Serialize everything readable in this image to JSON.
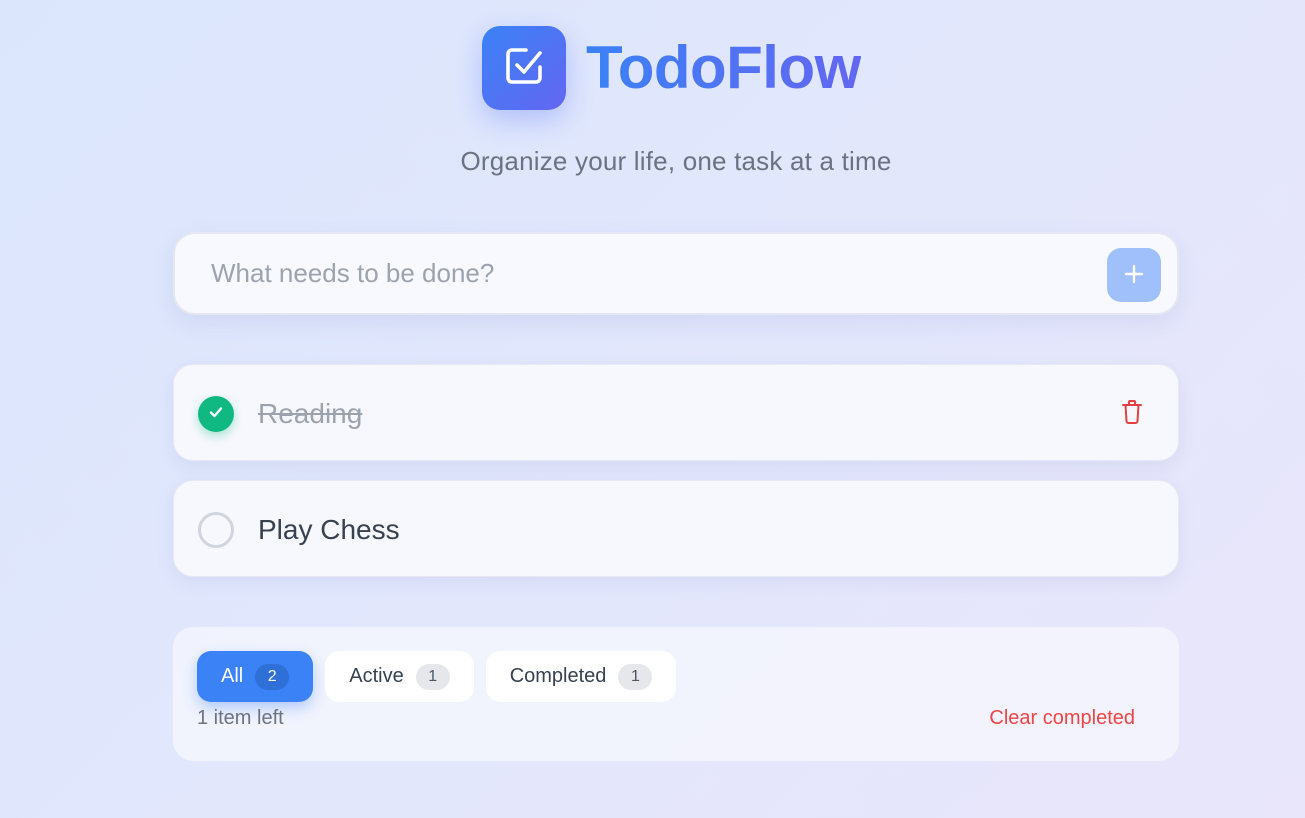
{
  "header": {
    "title": "TodoFlow",
    "tagline": "Organize your life, one task at a time",
    "logo_icon": "checkbox-icon"
  },
  "input": {
    "placeholder": "What needs to be done?",
    "value": "",
    "add_icon": "plus-icon"
  },
  "todos": [
    {
      "text": "Reading",
      "completed": true
    },
    {
      "text": "Play Chess",
      "completed": false
    }
  ],
  "filters": [
    {
      "label": "All",
      "count": "2",
      "active": true
    },
    {
      "label": "Active",
      "count": "1",
      "active": false
    },
    {
      "label": "Completed",
      "count": "1",
      "active": false
    }
  ],
  "footer": {
    "items_left": "1 item left",
    "clear_label": "Clear completed"
  },
  "colors": {
    "accent": "#3b82f6",
    "accent_secondary": "#6366f1",
    "success": "#10b981",
    "danger": "#ef4444"
  }
}
